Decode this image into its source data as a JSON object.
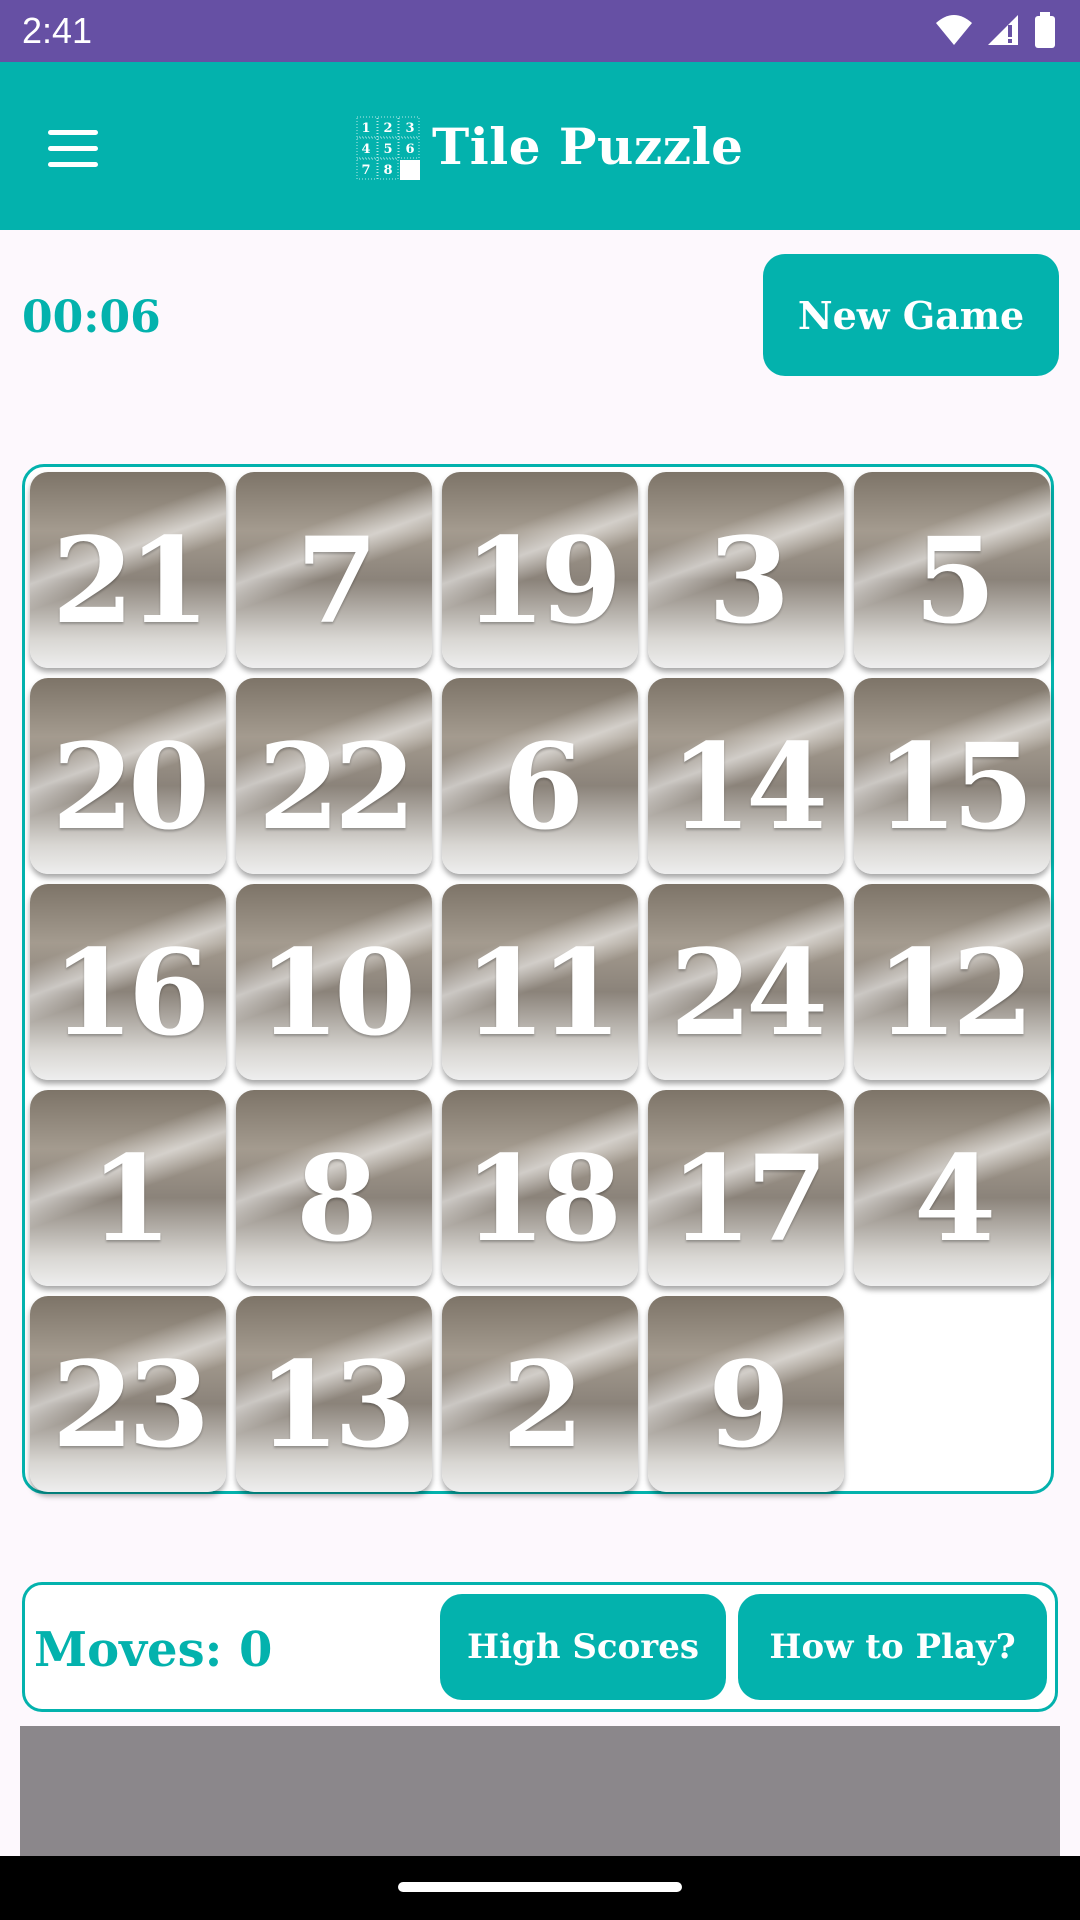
{
  "status_bar": {
    "time": "2:41",
    "icons": [
      "wifi-icon",
      "signal-icon",
      "battery-icon"
    ]
  },
  "app_bar": {
    "title": "Tile Puzzle",
    "logo_numbers": [
      "1",
      "2",
      "3",
      "4",
      "5",
      "6",
      "7",
      "8"
    ]
  },
  "game": {
    "timer": "00:06",
    "new_game_label": "New Game",
    "moves_label": "Moves: 0",
    "high_scores_label": "High Scores",
    "how_to_play_label": "How to Play?"
  },
  "board": {
    "rows": 5,
    "cols": 5,
    "tiles": [
      [
        "21",
        "7",
        "19",
        "3",
        "5"
      ],
      [
        "20",
        "22",
        "6",
        "14",
        "15"
      ],
      [
        "16",
        "10",
        "11",
        "24",
        "12"
      ],
      [
        "1",
        "8",
        "18",
        "17",
        "4"
      ],
      [
        "23",
        "13",
        "2",
        "9",
        ""
      ]
    ]
  },
  "colors": {
    "status_bar": "#6650a4",
    "primary": "#03b2ad",
    "background": "#fdf8fd",
    "ad_placeholder": "#8b878b"
  }
}
